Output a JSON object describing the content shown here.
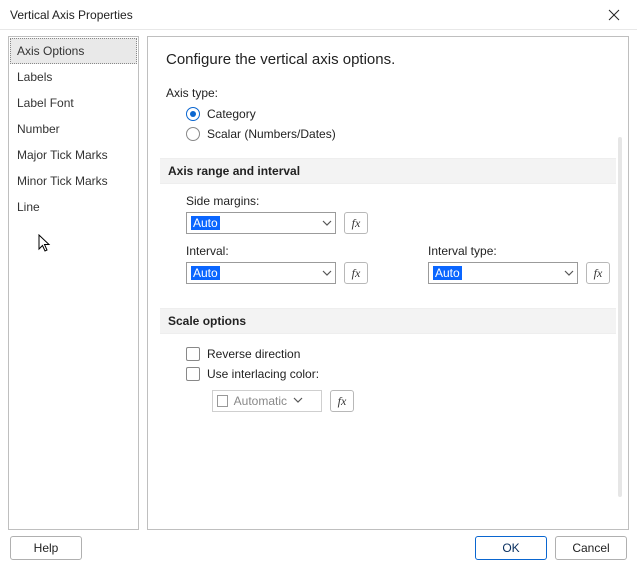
{
  "window": {
    "title": "Vertical Axis Properties"
  },
  "sidebar": {
    "items": [
      {
        "label": "Axis Options",
        "selected": true
      },
      {
        "label": "Labels"
      },
      {
        "label": "Label Font"
      },
      {
        "label": "Number"
      },
      {
        "label": "Major Tick Marks"
      },
      {
        "label": "Minor Tick Marks"
      },
      {
        "label": "Line"
      }
    ]
  },
  "main": {
    "heading": "Configure the vertical axis options.",
    "axis_type": {
      "label": "Axis type:",
      "options": [
        {
          "label": "Category",
          "checked": true
        },
        {
          "label": "Scalar (Numbers/Dates)",
          "checked": false
        }
      ]
    },
    "range_section": {
      "title": "Axis range and interval",
      "side_margins": {
        "label": "Side margins:",
        "value": "Auto"
      },
      "interval": {
        "label": "Interval:",
        "value": "Auto"
      },
      "interval_type": {
        "label": "Interval type:",
        "value": "Auto"
      }
    },
    "scale_section": {
      "title": "Scale options",
      "reverse": {
        "label": "Reverse direction",
        "checked": false
      },
      "interlace": {
        "label": "Use interlacing color:",
        "checked": false
      },
      "color": {
        "label": "Automatic"
      }
    }
  },
  "footer": {
    "help": "Help",
    "ok": "OK",
    "cancel": "Cancel"
  },
  "fx": "fx"
}
